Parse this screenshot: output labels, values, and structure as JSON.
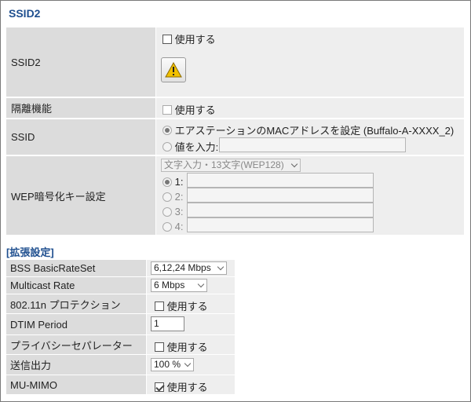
{
  "section_title": "SSID2",
  "rows": {
    "ssid2": {
      "label": "SSID2",
      "checkbox_label": "使用する"
    },
    "isolation": {
      "label": "隔離機能",
      "checkbox_label": "使用する"
    },
    "ssid": {
      "label": "SSID",
      "option1": "エアステーションのMACアドレスを設定 (Buffalo-A-XXXX_2)",
      "option2": "値を入力:",
      "value": ""
    },
    "wep": {
      "label": "WEP暗号化キー設定",
      "key_type": "文字入力・13文字(WEP128)",
      "keys": [
        {
          "label": "1:",
          "value": ""
        },
        {
          "label": "2:",
          "value": ""
        },
        {
          "label": "3:",
          "value": ""
        },
        {
          "label": "4:",
          "value": ""
        }
      ]
    }
  },
  "advanced": {
    "title": "[拡張設定]",
    "bss_basic_rate": {
      "label": "BSS BasicRateSet",
      "value": "6,12,24 Mbps"
    },
    "multicast_rate": {
      "label": "Multicast Rate",
      "value": "6 Mbps"
    },
    "protection": {
      "label": "802.11n プロテクション",
      "checkbox_label": "使用する",
      "checked": false
    },
    "dtim": {
      "label": "DTIM Period",
      "value": "1"
    },
    "privacy_separator": {
      "label": "プライバシーセパレーター",
      "checkbox_label": "使用する",
      "checked": false
    },
    "tx_power": {
      "label": "送信出力",
      "value": "100 %"
    },
    "mu_mimo": {
      "label": "MU-MIMO",
      "checkbox_label": "使用する",
      "checked": true
    }
  },
  "icons": {
    "warning": "warning-icon"
  },
  "colors": {
    "title": "#1f4f8f",
    "label_bg": "#dcdcdc",
    "value_bg": "#eeeeee",
    "warning": "#f2c100"
  }
}
